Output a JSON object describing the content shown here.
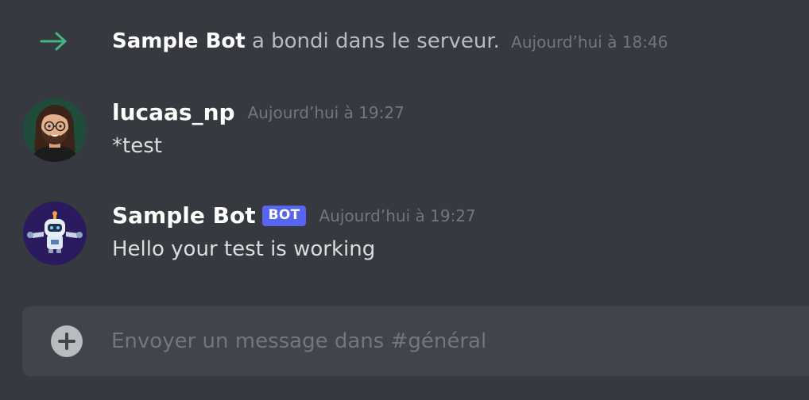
{
  "system_message": {
    "username": "Sample Bot",
    "action": "a bondi dans le serveur.",
    "timestamp": "Aujourd’hui à 18:46",
    "icon": "join-arrow-icon",
    "icon_color": "#43b581"
  },
  "messages": [
    {
      "username": "lucaas_np",
      "timestamp": "Aujourd’hui à 19:27",
      "content": "*test",
      "avatar": "user-avatar"
    },
    {
      "username": "Sample Bot",
      "badge": "BOT",
      "timestamp": "Aujourd’hui à 19:27",
      "content": "Hello your test is working",
      "avatar": "bot-avatar"
    }
  ],
  "composer": {
    "placeholder": "Envoyer un message dans #général",
    "value": "",
    "add_icon": "plus-circle-icon"
  },
  "colors": {
    "background": "#36393f",
    "composer_bg": "#40444b",
    "bot_badge": "#5865f2",
    "timestamp": "#72767d",
    "username": "#ffffff",
    "text": "#dcddde"
  }
}
